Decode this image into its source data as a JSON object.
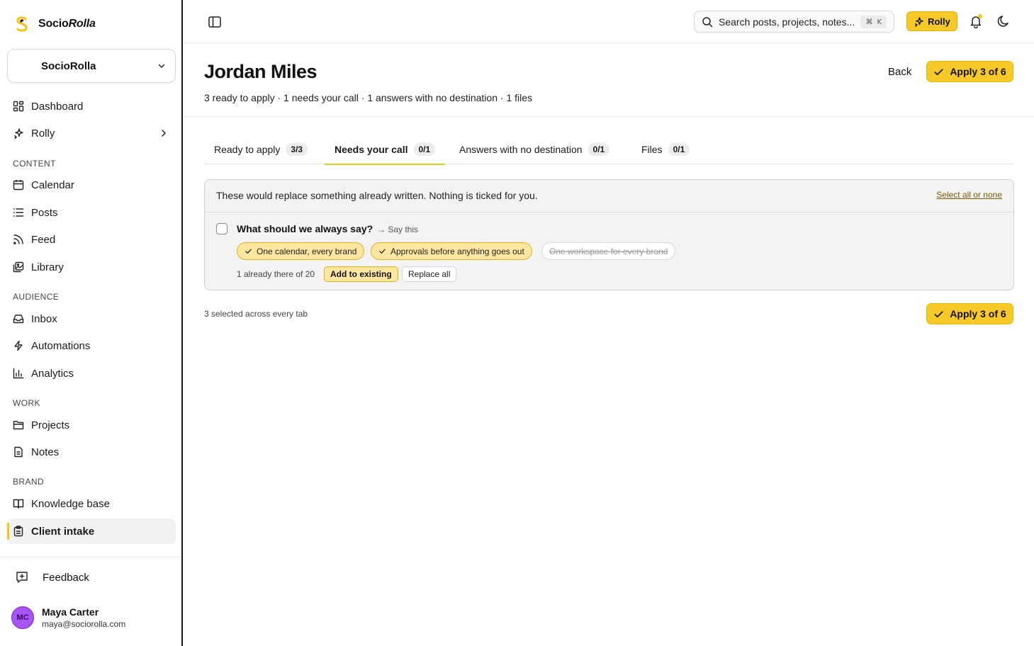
{
  "brand": {
    "name_part1": "Socio",
    "name_part2": "Rolla"
  },
  "workspace": {
    "label": "SocioRolla"
  },
  "nav": {
    "dashboard": "Dashboard",
    "rolly": "Rolly",
    "content_label": "CONTENT",
    "calendar": "Calendar",
    "posts": "Posts",
    "feed": "Feed",
    "library": "Library",
    "audience_label": "AUDIENCE",
    "inbox": "Inbox",
    "automations": "Automations",
    "analytics": "Analytics",
    "work_label": "WORK",
    "projects": "Projects",
    "notes": "Notes",
    "brand_label": "BRAND",
    "knowledge_base": "Knowledge base",
    "client_intake": "Client intake"
  },
  "feedback": "Feedback",
  "user": {
    "initials": "MC",
    "name": "Maya Carter",
    "email": "maya@sociorolla.com"
  },
  "topbar": {
    "search_placeholder": "Search posts, projects, notes...",
    "shortcut_symbol": "⌘",
    "shortcut_key": "K",
    "rolly_label": "Rolly"
  },
  "header": {
    "title": "Jordan Miles",
    "subtitle": "3 ready to apply · 1 needs your call · 1 answers with no destination · 1 files",
    "back_label": "Back",
    "apply_label": "Apply 3 of 6"
  },
  "tabs": [
    {
      "label": "Ready to apply",
      "count": "3/3"
    },
    {
      "label": "Needs your call",
      "count": "0/1"
    },
    {
      "label": "Answers with no destination",
      "count": "0/1"
    },
    {
      "label": "Files",
      "count": "0/1"
    }
  ],
  "card": {
    "header_text": "These would replace something already written. Nothing is ticked for you.",
    "select_all": "Select all or none",
    "question": "What should we always say?",
    "hint": "→ Say this",
    "chips": [
      {
        "label": "One calendar, every brand",
        "selected": true
      },
      {
        "label": "Approvals before anything goes out",
        "selected": true
      },
      {
        "label": "One workspace for every brand",
        "selected": false
      }
    ],
    "existing_text": "1 already there of 20",
    "add_existing": "Add to existing",
    "replace_all": "Replace all"
  },
  "footer": {
    "selected_text": "3 selected across every tab",
    "apply_label": "Apply 3 of 6"
  },
  "colors": {
    "accent": "#f7c928",
    "accent_soft": "#fde7a0",
    "avatar": "#a855f7"
  }
}
